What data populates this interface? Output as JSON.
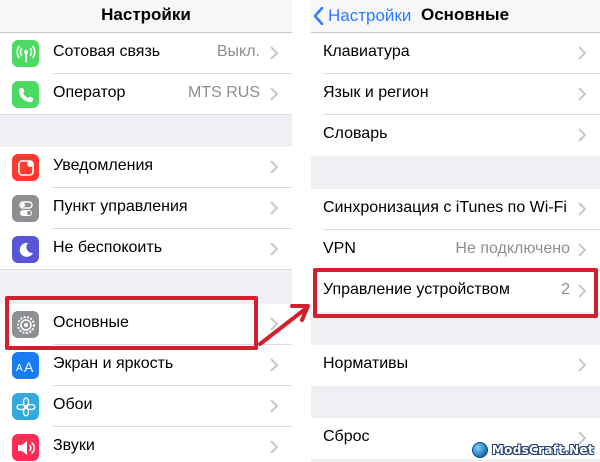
{
  "colors": {
    "accent": "#2b7cff",
    "highlight": "#d3202f",
    "cellular_icon": "#4cd964",
    "operator_icon": "#4cd964",
    "notifications_icon": "#ff3b30",
    "control_center_icon": "#8e8e93",
    "do_not_disturb_icon": "#5856d6",
    "general_icon": "#8e8e93",
    "display_icon": "#1a7cf4",
    "wallpaper_icon": "#34aadc",
    "sounds_icon": "#ff2d55"
  },
  "left": {
    "title": "Настройки",
    "rows": [
      {
        "label": "Сотовая связь",
        "value": "Выкл.",
        "icon": "cellular-icon"
      },
      {
        "label": "Оператор",
        "value": "MTS RUS",
        "icon": "phone-icon"
      },
      {
        "label": "Уведомления",
        "value": "",
        "icon": "notifications-icon"
      },
      {
        "label": "Пункт управления",
        "value": "",
        "icon": "toggles-icon"
      },
      {
        "label": "Не беспокоить",
        "value": "",
        "icon": "moon-icon"
      },
      {
        "label": "Основные",
        "value": "",
        "icon": "gear-icon"
      },
      {
        "label": "Экран и яркость",
        "value": "",
        "icon": "text-size-icon"
      },
      {
        "label": "Обои",
        "value": "",
        "icon": "flower-icon"
      },
      {
        "label": "Звуки",
        "value": "",
        "icon": "speaker-icon"
      }
    ]
  },
  "right": {
    "back_label": "Настройки",
    "title": "Основные",
    "rows": [
      {
        "label": "Клавиатура",
        "value": ""
      },
      {
        "label": "Язык и регион",
        "value": ""
      },
      {
        "label": "Словарь",
        "value": ""
      },
      {
        "label": "Синхронизация с iTunes по Wi-Fi",
        "value": ""
      },
      {
        "label": "VPN",
        "value": "Не подключено"
      },
      {
        "label": "Управление устройством",
        "value": "2"
      },
      {
        "label": "Нормативы",
        "value": ""
      },
      {
        "label": "Сброс",
        "value": ""
      }
    ]
  },
  "watermark": "ModsCraft.Net"
}
